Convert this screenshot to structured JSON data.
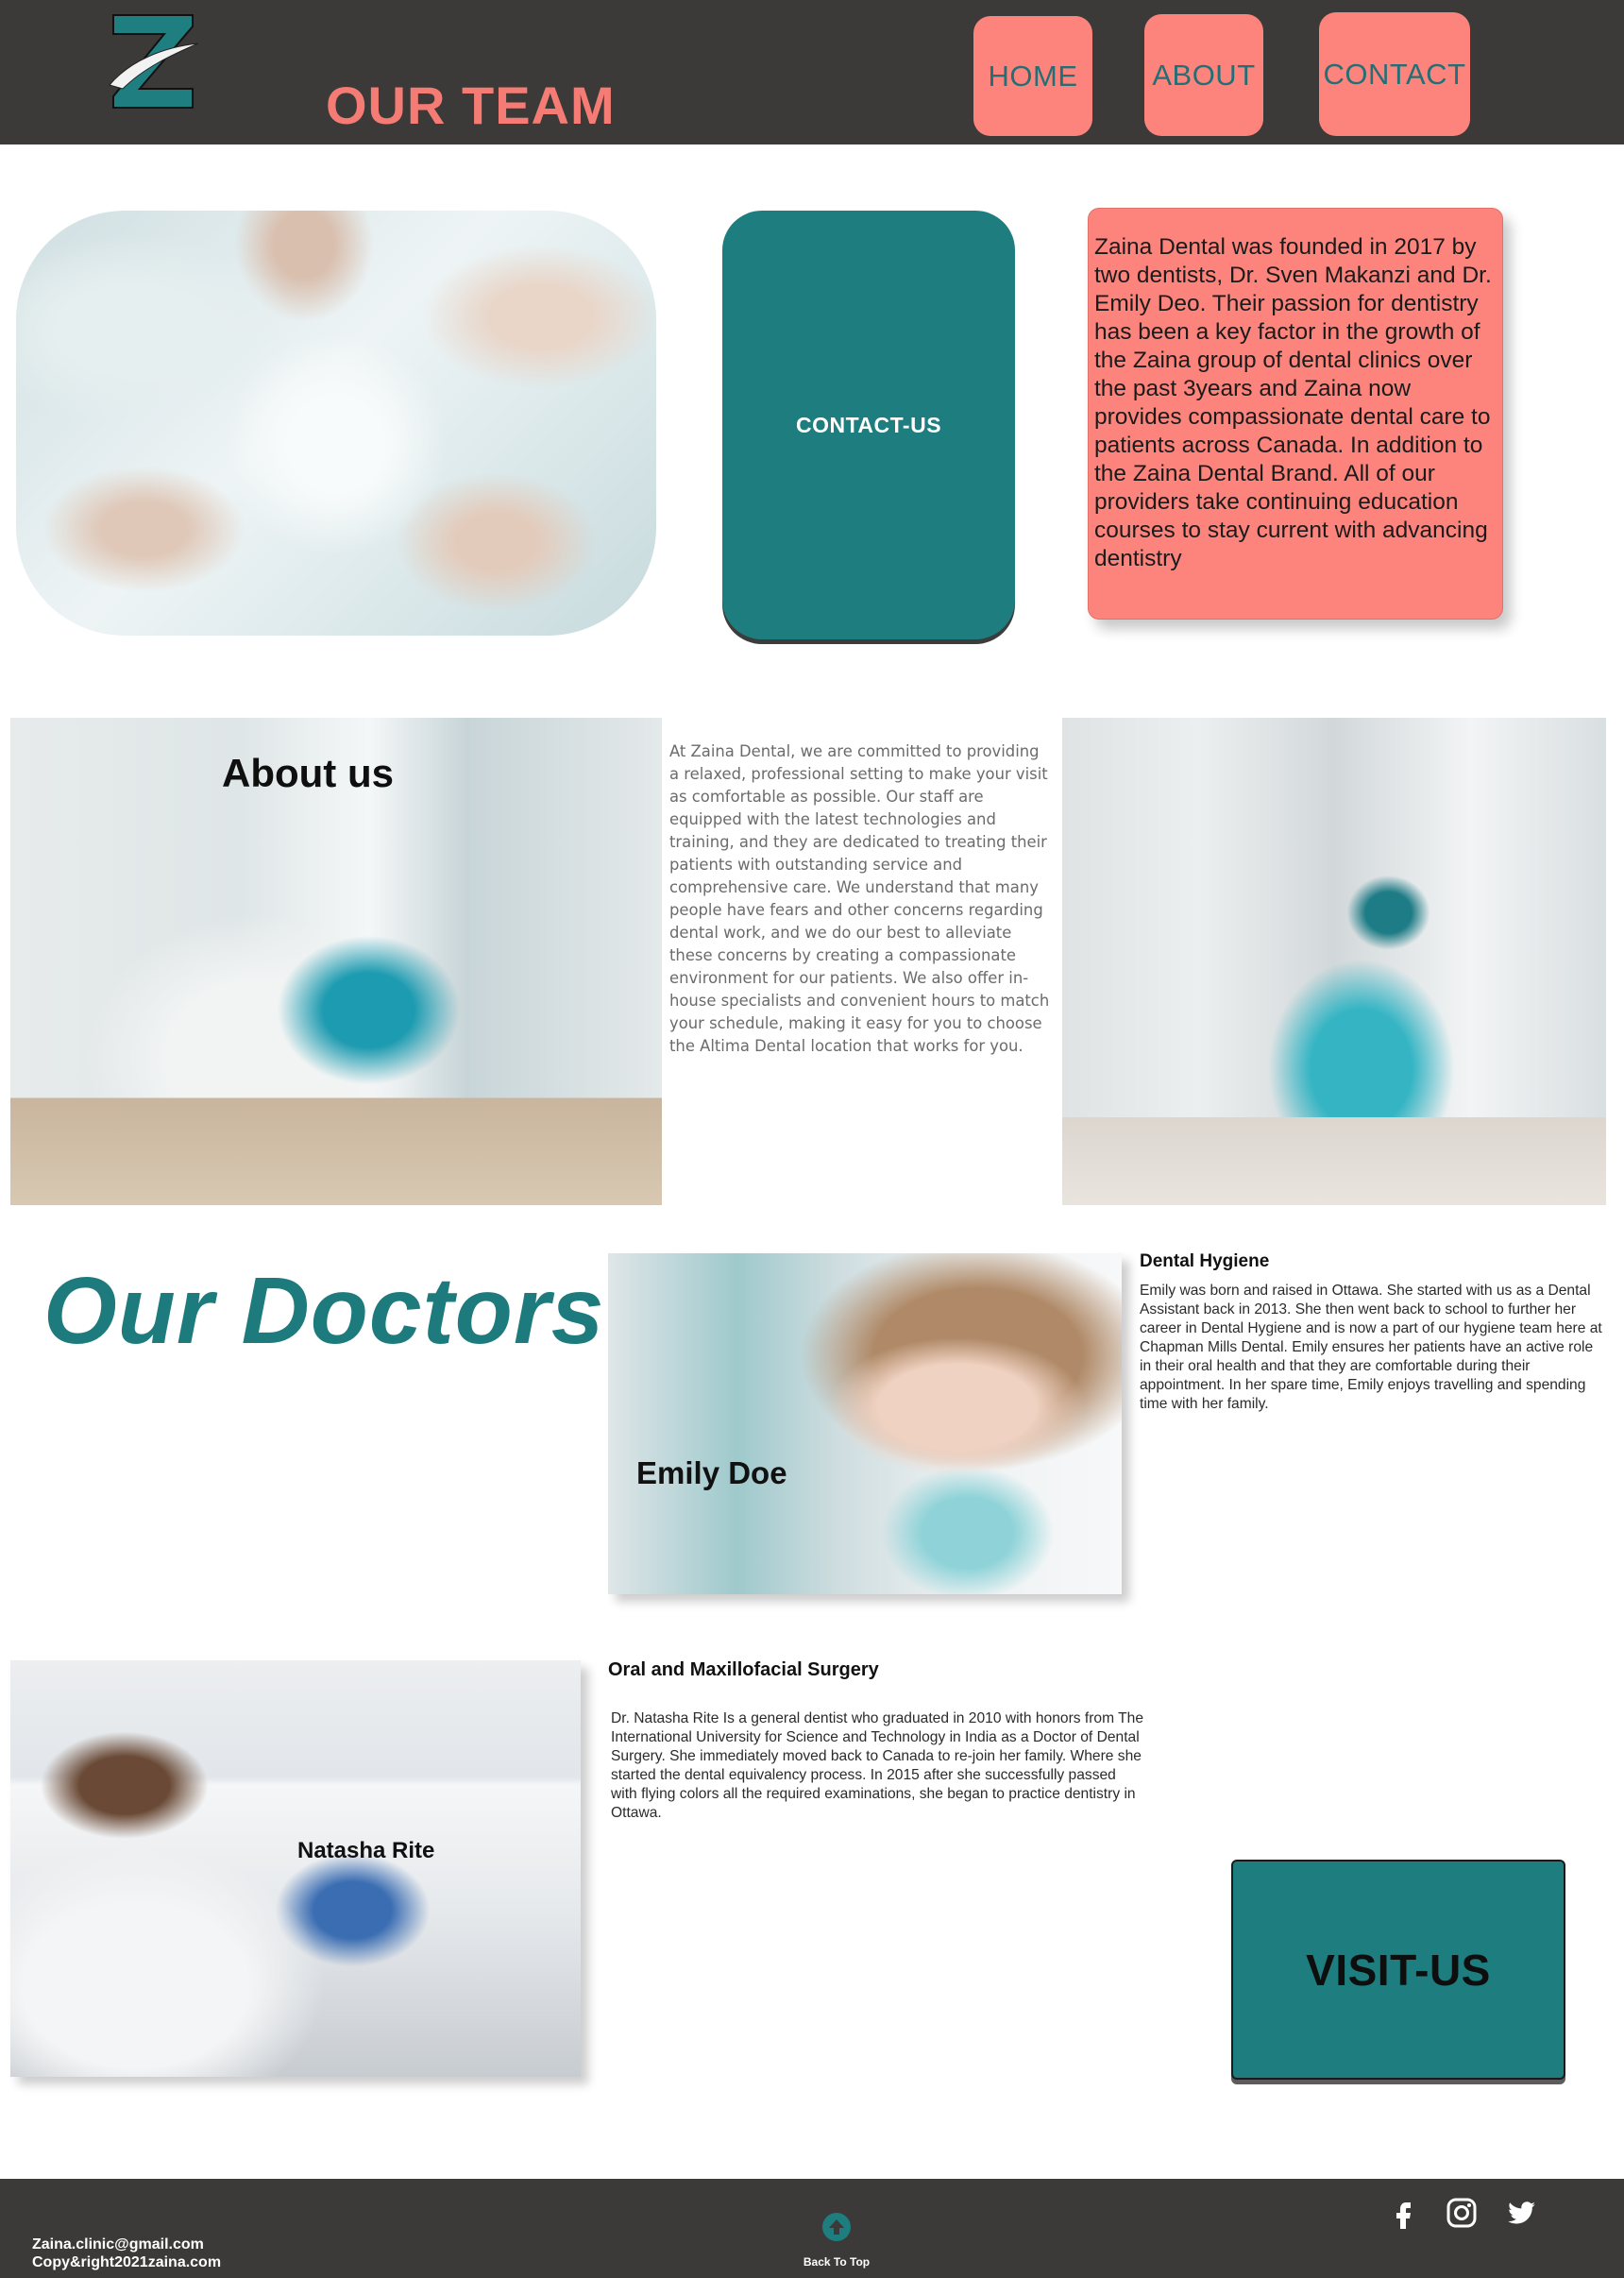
{
  "header": {
    "logo_icon": "zaina-z-logo",
    "title": "OUR TEAM",
    "nav": {
      "home": "HOME",
      "about": "ABOUT",
      "contact": "CONTACT"
    }
  },
  "hero": {
    "image_icon": "team-hands-photo",
    "contact_button": "CONTACT-US",
    "founded_text": "Zaina Dental was founded in 2017 by two dentists, Dr. Sven Makanzi and Dr. Emily Deo. Their passion for dentistry has been a key factor in the growth of the Zaina group of dental clinics over the past 3years and Zaina now provides compassionate dental care to patients across Canada. In addition to the Zaina Dental Brand. All of our providers take continuing education courses to stay current with advancing dentistry"
  },
  "about": {
    "title": "About us",
    "text": "At Zaina Dental, we are committed to providing a relaxed, professional setting to make your visit as comfortable as possible. Our staff are equipped with the latest technologies and training, and they are dedicated to treating their patients with outstanding service and comprehensive care. We understand that many people have fears and other concerns regarding dental work, and we do our best to alleviate these concerns by creating a compassionate environment for our patients. We also offer in-house specialists and convenient hours to match your schedule, making it easy for you to choose the Altima Dental location that works for you."
  },
  "doctors": {
    "title": "Our Doctors",
    "emily": {
      "name": "Emily Doe",
      "role": "Dental Hygiene",
      "bio": "Emily was born and raised in Ottawa. She started with us as a Dental Assistant back in 2013. She then went back to school to further her career in Dental Hygiene and is now a part of our hygiene team here at Chapman Mills Dental. Emily ensures her patients have an active role in their oral health and that they are comfortable during their appointment. In her spare time, Emily enjoys travelling and spending time with her family."
    },
    "natasha": {
      "name": "Natasha Rite",
      "role": "Oral and Maxillofacial Surgery",
      "bio": "Dr. Natasha Rite Is a general dentist who graduated in 2010 with honors from The International University for Science and Technology in India as a Doctor of Dental Surgery. She immediately moved back to Canada to re-join her family. Where she started the dental equivalency process. In 2015 after she successfully passed with flying colors all the required examinations, she began to practice dentistry in Ottawa."
    }
  },
  "visit_button": "VISIT-US",
  "footer": {
    "email": "Zaina.clinic@gmail.com",
    "copyright": "Copy&right2021zaina.com",
    "back_to_top": "Back To Top",
    "social_icons": [
      "facebook-icon",
      "instagram-icon",
      "twitter-icon"
    ]
  },
  "colors": {
    "header_bg": "#3b3a38",
    "accent_coral": "#fc847c",
    "accent_teal": "#1d7d7f",
    "title_coral": "#f47c74"
  }
}
